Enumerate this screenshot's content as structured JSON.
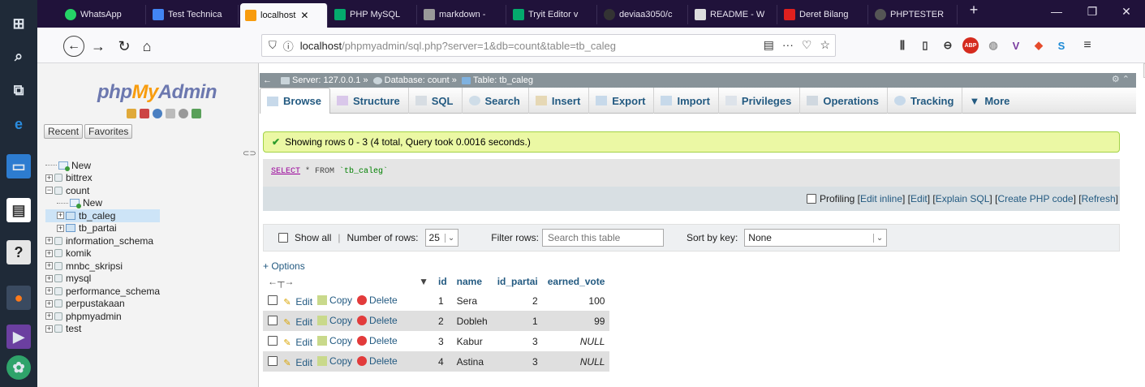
{
  "browser": {
    "tabs": [
      {
        "label": "WhatsApp",
        "color": "#25d366"
      },
      {
        "label": "Test Technica",
        "color": "#4285f4"
      },
      {
        "label": "localhost",
        "color": "#f89c0e",
        "active": true
      },
      {
        "label": "PHP MySQL",
        "color": "#04aa6d"
      },
      {
        "label": "markdown -",
        "color": "#999999"
      },
      {
        "label": "Tryit Editor v",
        "color": "#04aa6d"
      },
      {
        "label": "deviaa3050/c",
        "color": "#333333"
      },
      {
        "label": "README - W",
        "color": "#222222"
      },
      {
        "label": "Deret Bilang",
        "color": "#e0201e"
      },
      {
        "label": "PHPTESTER",
        "color": "#555555"
      }
    ],
    "url_main": "localhost",
    "url_rest": "/phpmyadmin/sql.php?server=1&db=count&table=tb_caleg"
  },
  "pma": {
    "logo_a": "php",
    "logo_b": "My",
    "logo_c": "Admin",
    "recent": "Recent",
    "favorites": "Favorites",
    "tree": [
      {
        "label": "New",
        "type": "new",
        "indent": 0
      },
      {
        "label": "bittrex",
        "type": "db",
        "indent": 0
      },
      {
        "label": "count",
        "type": "db-open",
        "indent": 0
      },
      {
        "label": "New",
        "type": "new",
        "indent": 1
      },
      {
        "label": "tb_caleg",
        "type": "table",
        "indent": 1,
        "selected": true
      },
      {
        "label": "tb_partai",
        "type": "table",
        "indent": 1
      },
      {
        "label": "information_schema",
        "type": "db",
        "indent": 0
      },
      {
        "label": "komik",
        "type": "db",
        "indent": 0
      },
      {
        "label": "mnbc_skripsi",
        "type": "db",
        "indent": 0
      },
      {
        "label": "mysql",
        "type": "db",
        "indent": 0
      },
      {
        "label": "performance_schema",
        "type": "db",
        "indent": 0
      },
      {
        "label": "perpustakaan",
        "type": "db",
        "indent": 0
      },
      {
        "label": "phpmyadmin",
        "type": "db",
        "indent": 0
      },
      {
        "label": "test",
        "type": "db",
        "indent": 0
      }
    ],
    "breadcrumb": {
      "server": "Server: 127.0.0.1",
      "database": "Database: count",
      "table": "Table: tb_caleg"
    },
    "tabs": [
      "Browse",
      "Structure",
      "SQL",
      "Search",
      "Insert",
      "Export",
      "Import",
      "Privileges",
      "Operations",
      "Tracking",
      "More"
    ],
    "success_msg": "Showing rows 0 - 3 (4 total, Query took 0.0016 seconds.)",
    "sql": {
      "kw": "SELECT",
      "rest": " * FROM ",
      "tbl": "`tb_caleg`"
    },
    "profiling": {
      "label": "Profiling",
      "links": [
        "Edit inline",
        "Edit",
        "Explain SQL",
        "Create PHP code",
        "Refresh"
      ]
    },
    "navigation": {
      "show_all": "Show all",
      "num_rows_label": "Number of rows:",
      "num_rows_value": "25",
      "filter_label": "Filter rows:",
      "filter_placeholder": "Search this table",
      "sort_label": "Sort by key:",
      "sort_value": "None"
    },
    "options_link": "+ Options",
    "columns": [
      "id",
      "name",
      "id_partai",
      "earned_vote"
    ],
    "actions": {
      "edit": "Edit",
      "copy": "Copy",
      "delete": "Delete"
    },
    "rows": [
      [
        "1",
        "Sera",
        "2",
        "100"
      ],
      [
        "2",
        "Dobleh",
        "1",
        "99"
      ],
      [
        "3",
        "Kabur",
        "3",
        "NULL"
      ],
      [
        "4",
        "Astina",
        "3",
        "NULL"
      ]
    ]
  }
}
